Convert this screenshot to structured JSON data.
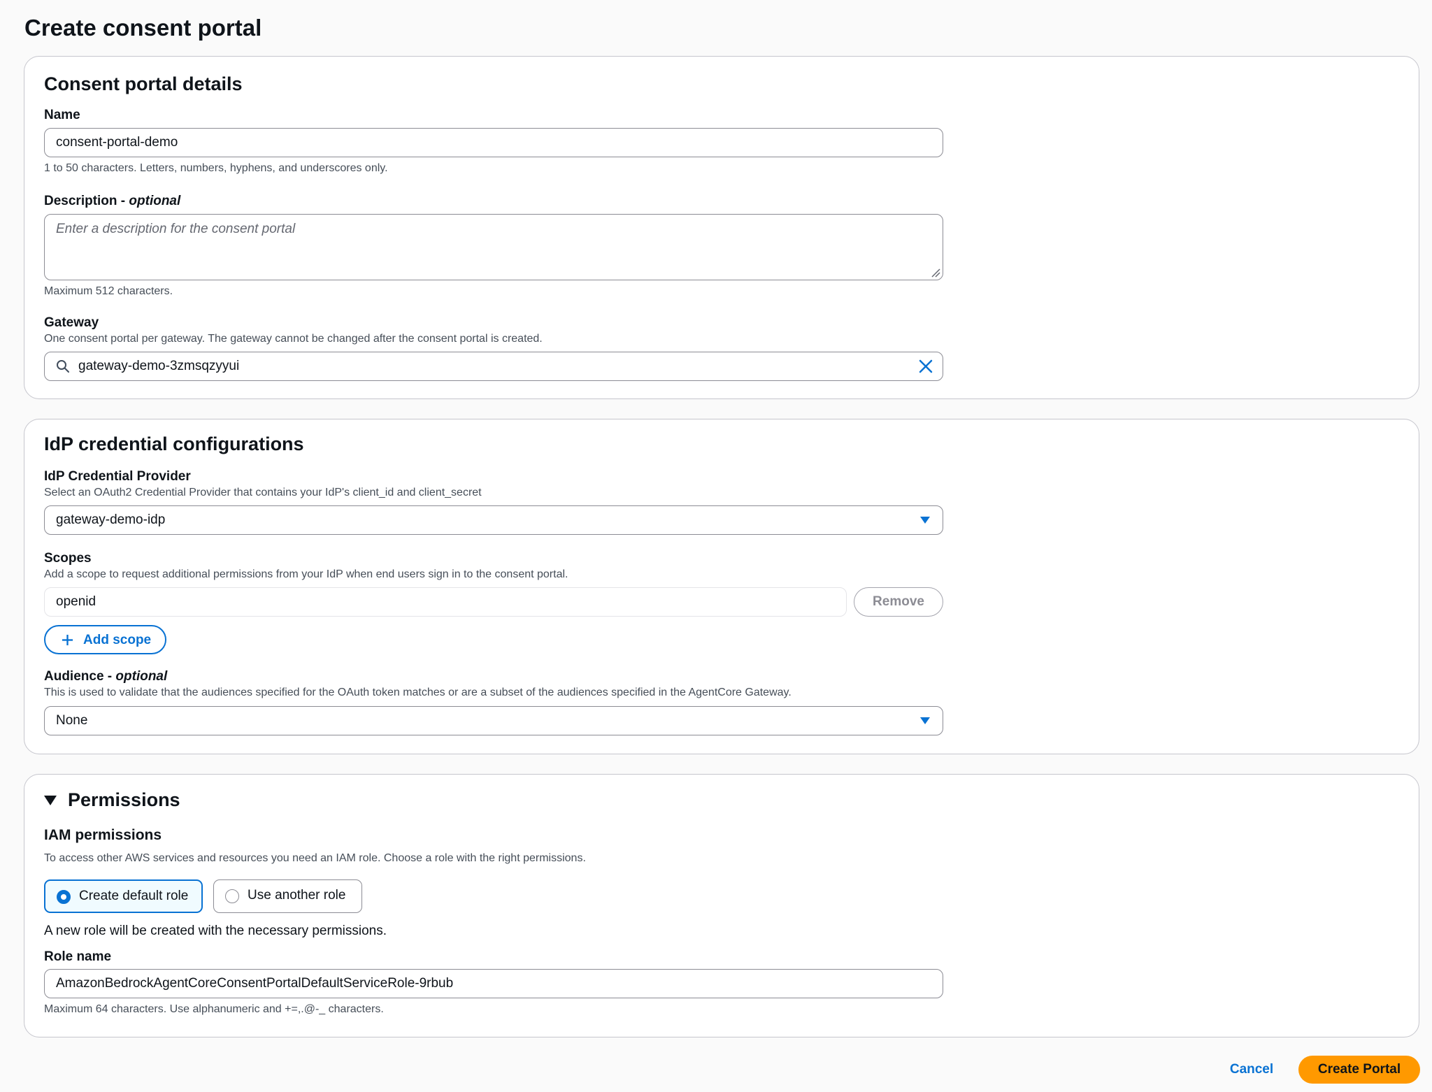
{
  "page": {
    "title": "Create consent portal"
  },
  "details": {
    "title": "Consent portal details",
    "name_label": "Name",
    "name_value": "consent-portal-demo",
    "name_hint": "1 to 50 characters. Letters, numbers, hyphens, and underscores only.",
    "description_label": "Description - ",
    "description_optional": "optional",
    "description_placeholder": "Enter a description for the consent portal",
    "description_hint": "Maximum 512 characters.",
    "gateway_label": "Gateway",
    "gateway_hint": "One consent portal per gateway. The gateway cannot be changed after the consent portal is created.",
    "gateway_value": "gateway-demo-3zmsqzyyui"
  },
  "idp": {
    "title": "IdP credential configurations",
    "provider_label": "IdP Credential Provider",
    "provider_hint": "Select an OAuth2 Credential Provider that contains your IdP's client_id and client_secret",
    "provider_value": "gateway-demo-idp",
    "scopes_label": "Scopes",
    "scopes_hint": "Add a scope to request additional permissions from your IdP when end users sign in to the consent portal.",
    "scopes": [
      {
        "value": "openid",
        "remove_label": "Remove"
      }
    ],
    "add_scope_label": "Add scope",
    "audience_label": "Audience - ",
    "audience_optional": "optional",
    "audience_hint": "This is used to validate that the audiences specified for the OAuth token matches or are a subset of the audiences specified in the AgentCore Gateway.",
    "audience_value": "None"
  },
  "permissions": {
    "title": "Permissions",
    "iam_title": "IAM permissions",
    "iam_hint": "To access other AWS services and resources you need an IAM role. Choose a role with the right permissions.",
    "options": [
      {
        "label": "Create default role",
        "selected": true
      },
      {
        "label": "Use another role",
        "selected": false
      }
    ],
    "info_text": "A new role will be created with the necessary permissions.",
    "role_name_label": "Role name",
    "role_name_value": "AmazonBedrockAgentCoreConsentPortalDefaultServiceRole-9rbub",
    "role_name_hint": "Maximum 64 characters. Use alphanumeric and +=,.@-_ characters."
  },
  "footer": {
    "cancel_label": "Cancel",
    "create_label": "Create Portal"
  },
  "colors": {
    "primary": "#0972d3",
    "cta": "#ff9900",
    "border": "#c6c6cd",
    "text": "#0f141a"
  }
}
